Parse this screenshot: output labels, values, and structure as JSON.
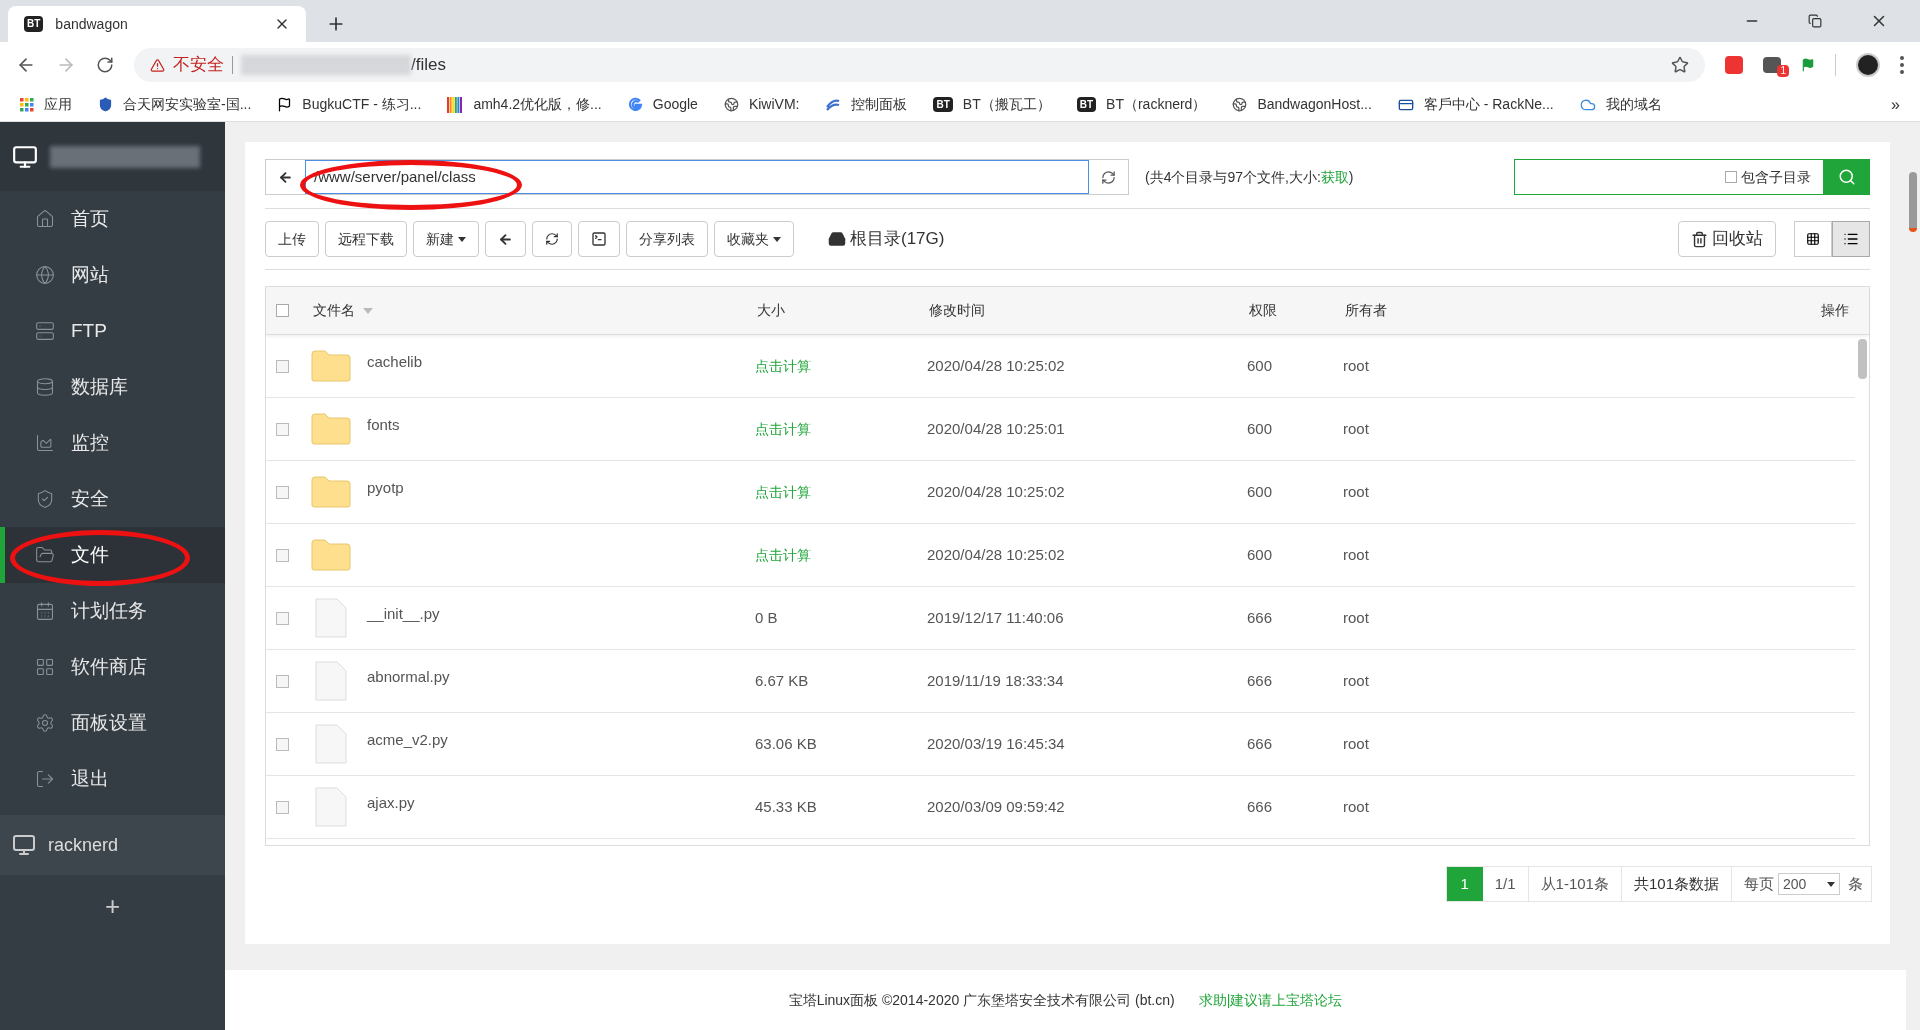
{
  "browser": {
    "tab_title": "bandwagon",
    "tab_badge": "BT",
    "security": "不安全",
    "url_path": "/files",
    "extension_count": "1",
    "bookmarks": [
      {
        "label": "应用",
        "kind": "apps"
      },
      {
        "label": "合天网安实验室-国...",
        "kind": "shield"
      },
      {
        "label": "BugkuCTF - 练习...",
        "kind": "flag"
      },
      {
        "label": "amh4.2优化版，修...",
        "kind": "bars"
      },
      {
        "label": "Google",
        "kind": "google"
      },
      {
        "label": "KiwiVM:",
        "kind": "globe"
      },
      {
        "label": "控制面板",
        "kind": "swirl"
      },
      {
        "label": "BT（搬瓦工）",
        "kind": "bt",
        "badge": "BT"
      },
      {
        "label": "BT（racknerd）",
        "kind": "bt",
        "badge": "BT"
      },
      {
        "label": "BandwagonHost...",
        "kind": "globe"
      },
      {
        "label": "客戶中心 - RackNe...",
        "kind": "card"
      },
      {
        "label": "我的域名",
        "kind": "cloud"
      }
    ],
    "more": "»"
  },
  "sidebar": {
    "items": [
      {
        "label": "首页",
        "kind": "home",
        "selected": false
      },
      {
        "label": "网站",
        "kind": "globe",
        "selected": false
      },
      {
        "label": "FTP",
        "kind": "ftp",
        "selected": false
      },
      {
        "label": "数据库",
        "kind": "db",
        "selected": false
      },
      {
        "label": "监控",
        "kind": "chart",
        "selected": false
      },
      {
        "label": "安全",
        "kind": "shield",
        "selected": false
      },
      {
        "label": "文件",
        "kind": "folder",
        "selected": true
      },
      {
        "label": "计划任务",
        "kind": "calendar",
        "selected": false
      },
      {
        "label": "软件商店",
        "kind": "grid",
        "selected": false
      },
      {
        "label": "面板设置",
        "kind": "gear",
        "selected": false
      },
      {
        "label": "退出",
        "kind": "exit",
        "selected": false
      }
    ],
    "server": "racknerd",
    "add": "+"
  },
  "path_bar": {
    "path": "/www/server/panel/class",
    "summary": "(共4个目录与97个文件,大小:",
    "summary_link": "获取",
    "summary_end": ")",
    "search_option": {
      "label": "包含子目录",
      "checked": false
    }
  },
  "toolbar": {
    "buttons": [
      {
        "kind": "text",
        "label": "上传"
      },
      {
        "kind": "text",
        "label": "远程下载"
      },
      {
        "kind": "dropdown",
        "label": "新建"
      },
      {
        "kind": "back"
      },
      {
        "kind": "refresh"
      },
      {
        "kind": "terminal"
      },
      {
        "kind": "text",
        "label": "分享列表"
      },
      {
        "kind": "dropdown",
        "label": "收藏夹"
      }
    ],
    "disk": "根目录(17G)",
    "recycle": "回收站",
    "views": [
      {
        "kind": "grid",
        "selected": false
      },
      {
        "kind": "list",
        "selected": true
      }
    ]
  },
  "table": {
    "columns": [
      "文件名",
      "大小",
      "修改时间",
      "权限",
      "所有者",
      "操作"
    ],
    "all_checked": false,
    "rows": [
      {
        "kind": "folder",
        "checked": false,
        "name": "cachelib",
        "size": "点击计算",
        "modified": "2020/04/28 10:25:02",
        "perm": "600",
        "owner": "root"
      },
      {
        "kind": "folder",
        "checked": false,
        "name": "fonts",
        "size": "点击计算",
        "modified": "2020/04/28 10:25:01",
        "perm": "600",
        "owner": "root"
      },
      {
        "kind": "folder",
        "checked": false,
        "name": "pyotp",
        "size": "点击计算",
        "modified": "2020/04/28 10:25:02",
        "perm": "600",
        "owner": "root"
      },
      {
        "kind": "folder",
        "checked": false,
        "size": "点击计算",
        "modified": "2020/04/28 10:25:02",
        "perm": "600",
        "owner": "root"
      },
      {
        "kind": "file",
        "checked": false,
        "name": "__init__.py",
        "size": "0 B",
        "modified": "2019/12/17 11:40:06",
        "perm": "666",
        "owner": "root"
      },
      {
        "kind": "file",
        "checked": false,
        "name": "abnormal.py",
        "size": "6.67 KB",
        "modified": "2019/11/19 18:33:34",
        "perm": "666",
        "owner": "root"
      },
      {
        "kind": "file",
        "checked": false,
        "name": "acme_v2.py",
        "size": "63.06 KB",
        "modified": "2020/03/19 16:45:34",
        "perm": "666",
        "owner": "root"
      },
      {
        "kind": "file",
        "checked": false,
        "name": "ajax.py",
        "size": "45.33 KB",
        "modified": "2020/03/09 09:59:42",
        "perm": "666",
        "owner": "root"
      }
    ]
  },
  "pagination": {
    "current": "1",
    "pages": "1/1",
    "range": "从1-101条",
    "total": "共101条数据",
    "per_page_label": "每页",
    "per_page": "200",
    "unit": "条"
  },
  "footer": {
    "text": "宝塔Linux面板 ©2014-2020 广东堡塔安全技术有限公司 (bt.cn)",
    "link": "求助|建议请上宝塔论坛"
  }
}
